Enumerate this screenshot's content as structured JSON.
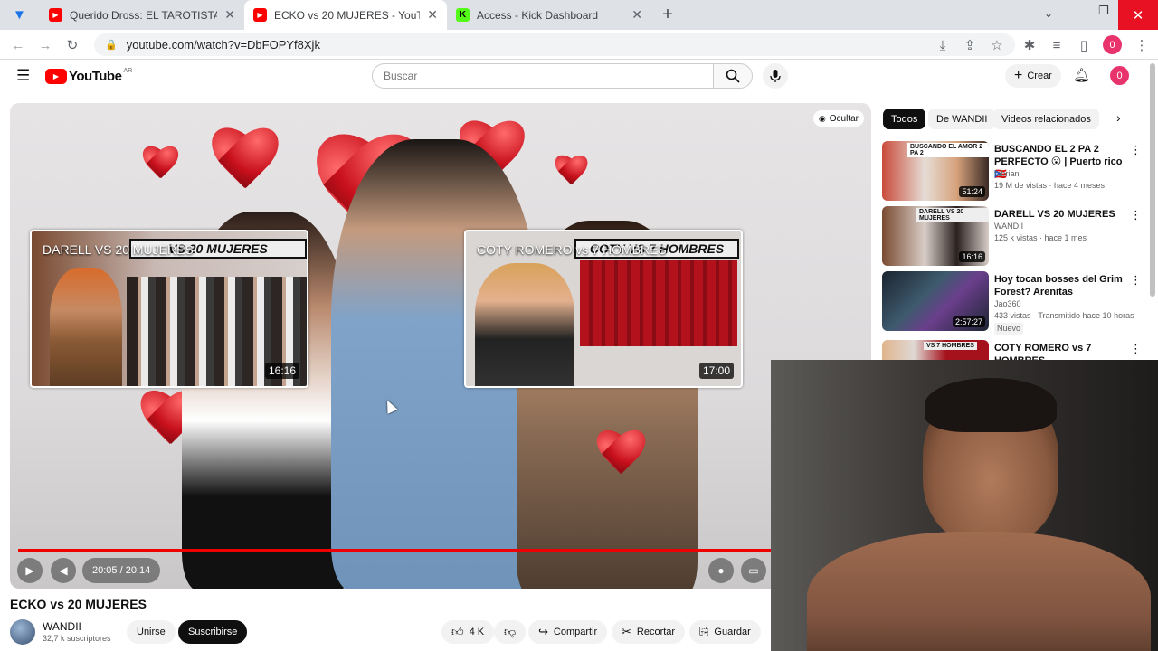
{
  "browser": {
    "tabs": [
      {
        "title": "Querido Dross: EL TAROTISTA - Y",
        "active": false
      },
      {
        "title": "ECKO vs 20 MUJERES - YouTube",
        "active": true
      },
      {
        "title": "Access - Kick Dashboard",
        "active": false
      }
    ],
    "new_tab_label": "+",
    "url": "youtube.com/watch?v=DbFOPYf8Xjk",
    "profile_initial": "0"
  },
  "youtube": {
    "logo_text": "YouTube",
    "logo_region": "AR",
    "search_placeholder": "Buscar",
    "create_label": "Crear",
    "avatar_initial": "0"
  },
  "player": {
    "hide_label": "Ocultar",
    "time": "20:05 / 20:14",
    "progress": 0.99,
    "endcards": [
      {
        "title": "DARELL VS 20 MUJERES",
        "banner": "VS 20 MUJERES",
        "duration": "16:16"
      },
      {
        "title": "COTY ROMERO vs 7 HOMBRES",
        "banner": "COTY VS 7 HOMBRES",
        "duration": "17:00"
      }
    ]
  },
  "video": {
    "title": "ECKO vs 20 MUJERES",
    "channel": "WANDII",
    "subscribers": "32,7 k suscriptores",
    "join_label": "Unirse",
    "subscribe_label": "Suscribirse",
    "likes": "4 K",
    "share_label": "Compartir",
    "clip_label": "Recortar",
    "save_label": "Guardar"
  },
  "sidebar": {
    "chips": [
      "Todos",
      "De WANDII",
      "Videos relacionados"
    ],
    "videos": [
      {
        "title": "BUSCANDO EL 2 PA 2 PERFECTO 😮 | Puerto rico 🇵🇷",
        "channel": "fabrian",
        "meta": "19 M de vistas · hace 4 meses",
        "duration": "51:24",
        "thumb_text": "BUSCANDO EL AMOR 2 PA 2"
      },
      {
        "title": "DARELL VS 20 MUJERES",
        "channel": "WANDII",
        "meta": "125 k vistas · hace 1 mes",
        "duration": "16:16",
        "thumb_text": "DARELL VS 20 MUJERES"
      },
      {
        "title": "Hoy tocan bosses del Grim Forest? Arenitas",
        "channel": "Jao360",
        "meta": "433 vistas · Transmitido hace 10 horas",
        "badge": "Nuevo",
        "duration": "2:57:27"
      },
      {
        "title": "COTY ROMERO vs 7 HOMBRES",
        "channel": "",
        "meta": "",
        "thumb_text": "VS 7 HOMBRES"
      }
    ]
  },
  "colors": {
    "accent": "#ff0000",
    "kick_green": "#53fc18",
    "profile_pink": "#e8336d"
  }
}
